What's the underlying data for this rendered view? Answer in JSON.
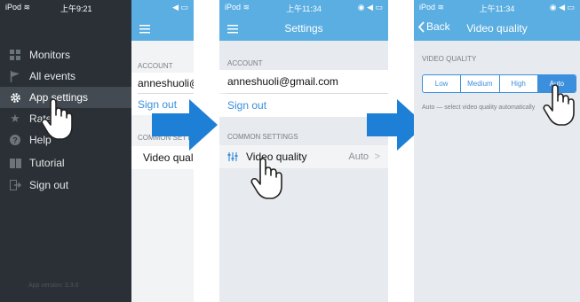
{
  "panel1": {
    "status": {
      "carrier": "iPod",
      "time": "上午9:21"
    },
    "menu": [
      {
        "label": "Monitors",
        "icon": "grid-icon"
      },
      {
        "label": "All events",
        "icon": "flag-icon"
      },
      {
        "label": "App settings",
        "icon": "gear-icon",
        "selected": true
      },
      {
        "label": "Rate",
        "icon": "star-icon"
      },
      {
        "label": "Help",
        "icon": "help-icon"
      },
      {
        "label": "Tutorial",
        "icon": "book-icon"
      },
      {
        "label": "Sign out",
        "icon": "sign-out-icon"
      }
    ],
    "version": "App version: 3.3.0",
    "behind": {
      "account_head": "ACCOUNT",
      "email": "anneshuoli@gmail.com",
      "sign_out": "Sign out",
      "common_head": "COMMON SETTINGS",
      "video_quality": "Video quality"
    }
  },
  "panel2": {
    "status": {
      "carrier": "iPod",
      "time": "上午11:34"
    },
    "title": "Settings",
    "account_head": "ACCOUNT",
    "email": "anneshuoli@gmail.com",
    "sign_out": "Sign out",
    "common_head": "COMMON SETTINGS",
    "video_quality": "Video quality",
    "video_quality_value": "Auto",
    "chevron": ">"
  },
  "panel3": {
    "status": {
      "carrier": "iPod",
      "time": "上午11:34"
    },
    "back": "Back",
    "title": "Video quality",
    "section_head": "VIDEO QUALITY",
    "options": [
      "Low",
      "Medium",
      "High",
      "Auto"
    ],
    "selected": "Auto",
    "description": "Auto — select video quality automatically"
  },
  "colors": {
    "nav_blue": "#5aaee2",
    "accent_blue": "#3b8fdc",
    "menu_dark": "#2a3036",
    "arrow_blue": "#1e7fd6"
  }
}
